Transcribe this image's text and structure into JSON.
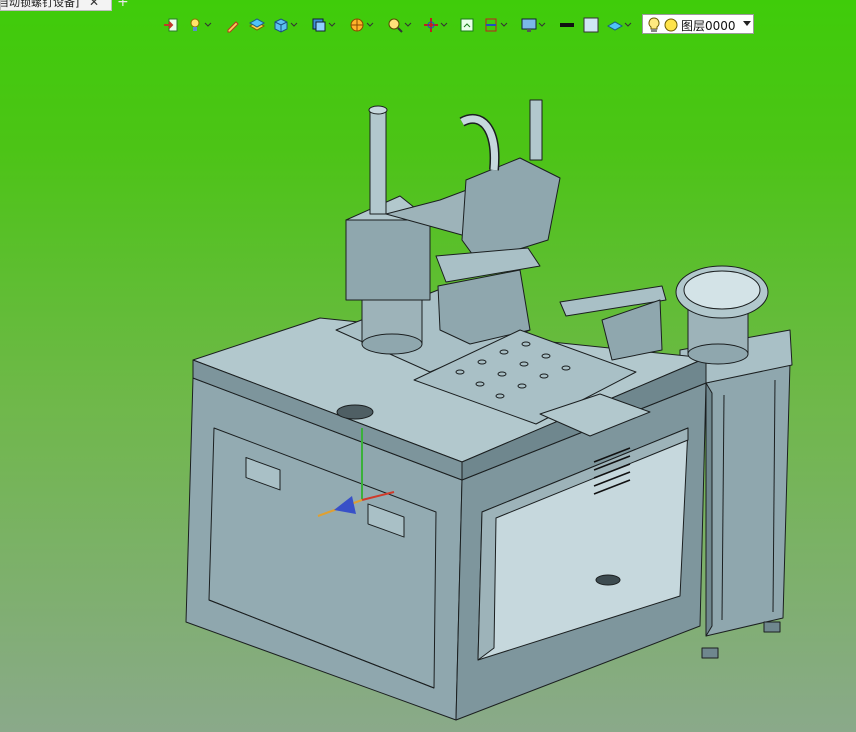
{
  "tab": {
    "title": "自动锁螺钉设备]",
    "close_glyph": "✕",
    "new_glyph": "+"
  },
  "toolbar": {
    "buttons": [
      {
        "name": "exit-icon",
        "has_dropdown": false
      },
      {
        "name": "lightbulb-icon",
        "has_dropdown": true
      },
      {
        "name": "pen-icon",
        "has_dropdown": false
      },
      {
        "name": "layers-icon",
        "has_dropdown": false
      },
      {
        "name": "cube-icon",
        "has_dropdown": true
      },
      {
        "name": "view-cube-icon",
        "has_dropdown": true
      },
      {
        "name": "sphere-icon",
        "has_dropdown": true
      },
      {
        "name": "zoom-icon",
        "has_dropdown": true
      },
      {
        "name": "axis-icon",
        "has_dropdown": true
      },
      {
        "name": "frame-icon",
        "has_dropdown": false
      },
      {
        "name": "section-icon",
        "has_dropdown": true
      },
      {
        "name": "display-icon",
        "has_dropdown": true
      },
      {
        "name": "line-icon",
        "has_dropdown": false
      },
      {
        "name": "color-icon",
        "has_dropdown": false
      },
      {
        "name": "plane-icon",
        "has_dropdown": true
      }
    ]
  },
  "layer": {
    "name": "图层0000"
  },
  "colors": {
    "machine_face": "#8fa7ae",
    "machine_light": "#a9c0c6",
    "machine_dark": "#6f878e",
    "outline": "#1b1f20"
  }
}
